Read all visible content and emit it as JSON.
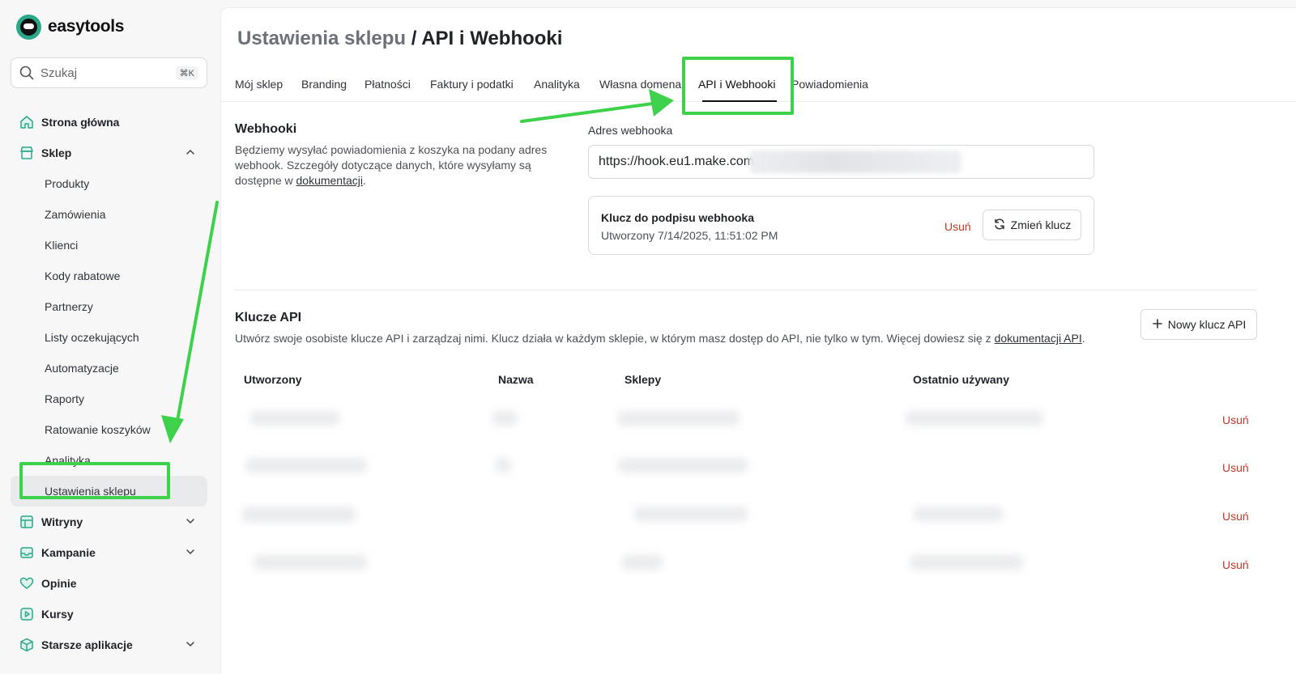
{
  "app": {
    "brand": "easytools"
  },
  "search": {
    "placeholder": "Szukaj",
    "shortcut": "⌘K"
  },
  "sidebar": {
    "items": [
      {
        "label": "Strona główna",
        "icon": "home-icon"
      },
      {
        "label": "Sklep",
        "icon": "store-icon",
        "expanded": true
      },
      {
        "label": "Witryny",
        "icon": "layout-icon"
      },
      {
        "label": "Kampanie",
        "icon": "inbox-icon"
      },
      {
        "label": "Opinie",
        "icon": "heart-icon"
      },
      {
        "label": "Kursy",
        "icon": "play-icon"
      },
      {
        "label": "Starsze aplikacje",
        "icon": "box-icon"
      }
    ],
    "shop_subitems": [
      "Produkty",
      "Zamówienia",
      "Klienci",
      "Kody rabatowe",
      "Partnerzy",
      "Listy oczekujących",
      "Automatyzacje",
      "Raporty",
      "Ratowanie koszyków",
      "Analityka",
      "Ustawienia sklepu"
    ],
    "active_subitem": "Ustawienia sklepu"
  },
  "page": {
    "breadcrumb": "Ustawienia sklepu",
    "separator": " / ",
    "title": "API i Webhooki"
  },
  "tabs": [
    "Mój sklep",
    "Branding",
    "Płatności",
    "Faktury i podatki",
    "Analityka",
    "Własna domena",
    "API i Webhooki",
    "Powiadomienia"
  ],
  "active_tab": "API i Webhooki",
  "webhooks": {
    "title": "Webhooki",
    "desc_line1": "Będziemy wysyłać powiadomienia z koszyka na podany adres",
    "desc_line2": "webhook. Szczegóły dotyczące danych, które wysyłamy są",
    "desc_line3": "dostępne w ",
    "desc_link": "dokumentacji",
    "desc_end": ".",
    "field_label": "Adres webhooka",
    "url_value": "https://hook.eu1.make.com/",
    "signing_key": {
      "title": "Klucz do podpisu webhooka",
      "created": "Utworzony 7/14/2025, 11:51:02 PM",
      "delete_label": "Usuń",
      "change_label": "Zmień klucz"
    }
  },
  "api_keys": {
    "title": "Klucze API",
    "desc": "Utwórz swoje osobiste klucze API i zarządzaj nimi. Klucz działa w każdym sklepie, w którym masz dostęp do API, nie tylko w tym. Więcej dowiesz się z ",
    "desc_link": "dokumentacji API",
    "desc_end": ".",
    "new_key_label": "Nowy klucz API",
    "columns": [
      "Utworzony",
      "Nazwa",
      "Sklepy",
      "Ostatnio używany"
    ],
    "row_delete_labels": [
      "Usuń",
      "Usuń",
      "Usuń",
      "Usuń"
    ]
  },
  "colors": {
    "annotation": "#3ed14b",
    "danger": "#c0392b",
    "brand": "#2aa889"
  }
}
